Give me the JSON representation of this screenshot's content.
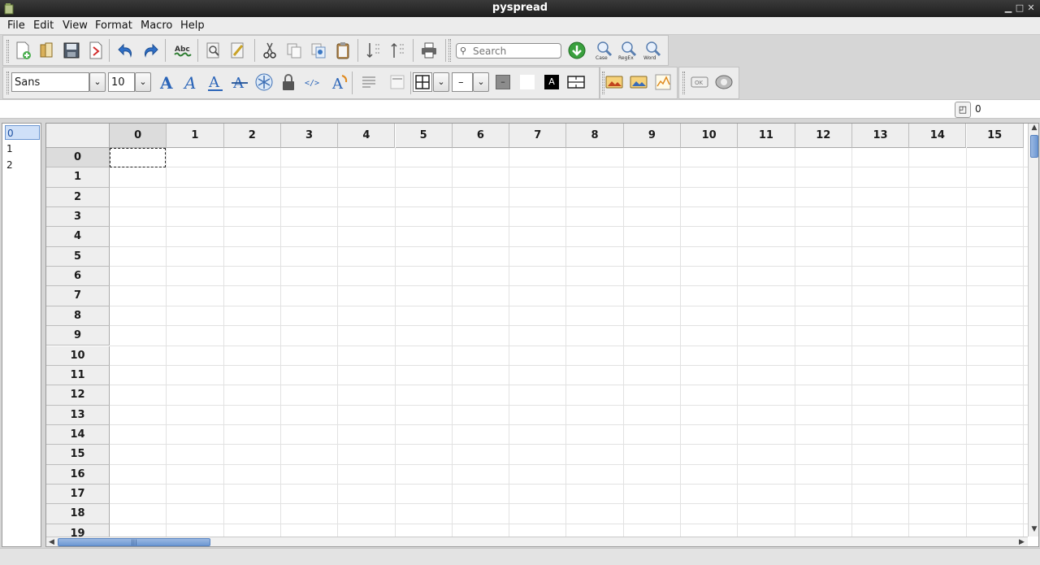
{
  "window": {
    "title": "pyspread"
  },
  "menu": [
    {
      "label": "File",
      "mnemonic": "F",
      "rest": "ile"
    },
    {
      "label": "Edit",
      "mnemonic": "E",
      "rest": "dit"
    },
    {
      "label": "View",
      "mnemonic": "V",
      "rest": "iew"
    },
    {
      "label": "Format",
      "mnemonic": "o",
      "prefix": "F",
      "rest": "rmat"
    },
    {
      "label": "Macro",
      "mnemonic": "M",
      "rest": "acro"
    },
    {
      "label": "Help",
      "mnemonic": "H",
      "rest": "elp"
    }
  ],
  "search": {
    "placeholder": "Search"
  },
  "search_options": {
    "case": "Case",
    "regex": "RegEx",
    "word": "Word"
  },
  "format": {
    "font": "Sans",
    "font_size": "10",
    "line_style": "–"
  },
  "entry_line": {
    "value": "",
    "zoom_value": "0"
  },
  "tables": {
    "items": [
      "0",
      "1",
      "2"
    ],
    "selected": "0"
  },
  "grid": {
    "columns": [
      "0",
      "1",
      "2",
      "3",
      "4",
      "5",
      "6",
      "7",
      "8",
      "9",
      "10",
      "11",
      "12",
      "13",
      "14",
      "15"
    ],
    "rows": [
      "0",
      "1",
      "2",
      "3",
      "4",
      "5",
      "6",
      "7",
      "8",
      "9",
      "10",
      "11",
      "12",
      "13",
      "14",
      "15",
      "16",
      "17",
      "18",
      "19"
    ],
    "selected_cell": {
      "row": "0",
      "col": "0"
    }
  },
  "colors": {
    "accent": "#6d98d3",
    "selection": "#cfe0f8"
  }
}
